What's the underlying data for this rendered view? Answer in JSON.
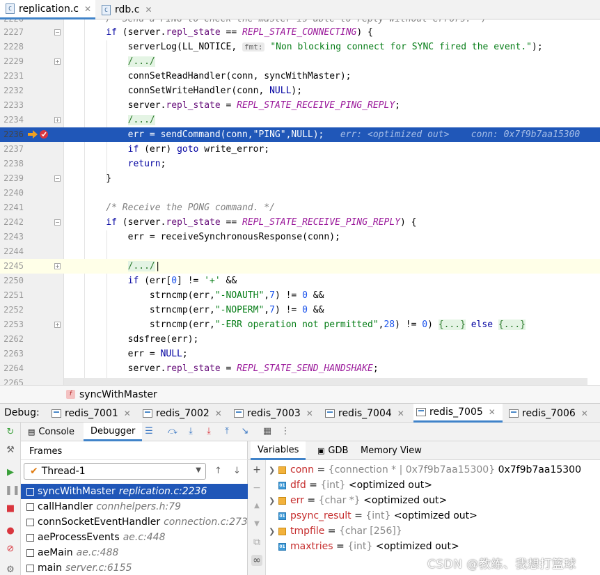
{
  "editor_tabs": [
    {
      "label": "replication.c",
      "icon": "c-file-icon",
      "active": true
    },
    {
      "label": "rdb.c",
      "icon": "c-file-icon",
      "active": false
    }
  ],
  "code_lines": [
    {
      "num": "2226",
      "text": "    /* Send a PING to check the master is able to reply without errors. */"
    },
    {
      "num": "2227",
      "text": "    if (server.repl_state == REPL_STATE_CONNECTING) {"
    },
    {
      "num": "2228",
      "text": "        serverLog(LL_NOTICE, fmt: \"Non blocking connect for SYNC fired the event.\");"
    },
    {
      "num": "2229",
      "text": "        /.../"
    },
    {
      "num": "2231",
      "text": "        connSetReadHandler(conn, syncWithMaster);"
    },
    {
      "num": "2232",
      "text": "        connSetWriteHandler(conn, NULL);"
    },
    {
      "num": "2233",
      "text": "        server.repl_state = REPL_STATE_RECEIVE_PING_REPLY;"
    },
    {
      "num": "2234",
      "text": "        /.../"
    },
    {
      "num": "2236",
      "text": "        err = sendCommand(conn,\"PING\",NULL);"
    },
    {
      "num": "2237",
      "text": "        if (err) goto write_error;"
    },
    {
      "num": "2238",
      "text": "        return;"
    },
    {
      "num": "2239",
      "text": "    }"
    },
    {
      "num": "2240",
      "text": ""
    },
    {
      "num": "2241",
      "text": "    /* Receive the PONG command. */"
    },
    {
      "num": "2242",
      "text": "    if (server.repl_state == REPL_STATE_RECEIVE_PING_REPLY) {"
    },
    {
      "num": "2243",
      "text": "        err = receiveSynchronousResponse(conn);"
    },
    {
      "num": "2244",
      "text": ""
    },
    {
      "num": "2245",
      "text": "        /.../"
    },
    {
      "num": "2250",
      "text": "        if (err[0] != '+' &&"
    },
    {
      "num": "2251",
      "text": "            strncmp(err,\"-NOAUTH\",7) != 0 &&"
    },
    {
      "num": "2252",
      "text": "            strncmp(err,\"-NOPERM\",7) != 0 &&"
    },
    {
      "num": "2253",
      "text": "            strncmp(err,\"-ERR operation not permitted\",28) != 0) {...} else {...}"
    },
    {
      "num": "2262",
      "text": "        sdsfree(err);"
    },
    {
      "num": "2263",
      "text": "        err = NULL;"
    },
    {
      "num": "2264",
      "text": "        server.repl_state = REPL_STATE_SEND_HANDSHAKE;"
    },
    {
      "num": "2265",
      "text": "    }"
    }
  ],
  "inline_values": {
    "err": "err: <optimized out>",
    "conn": "conn: 0x7f9b7aa15300"
  },
  "breadcrumb": {
    "badge": "f",
    "label": "syncWithMaster"
  },
  "debug": {
    "label": "Debug:",
    "sessions": [
      {
        "label": "redis_7001"
      },
      {
        "label": "redis_7002"
      },
      {
        "label": "redis_7003"
      },
      {
        "label": "redis_7004"
      },
      {
        "label": "redis_7005",
        "active": true
      },
      {
        "label": "redis_7006"
      }
    ],
    "subtabs": {
      "console": "Console",
      "debugger": "Debugger"
    },
    "frames_title": "Frames",
    "thread": "Thread-1",
    "frames": [
      {
        "fn": "syncWithMaster",
        "loc": "replication.c:2236",
        "selected": true
      },
      {
        "fn": "callHandler",
        "loc": "connhelpers.h:79"
      },
      {
        "fn": "connSocketEventHandler",
        "loc": "connection.c:273"
      },
      {
        "fn": "aeProcessEvents",
        "loc": "ae.c:448"
      },
      {
        "fn": "aeMain",
        "loc": "ae.c:488"
      },
      {
        "fn": "main",
        "loc": "server.c:6155"
      }
    ],
    "var_tabs": {
      "variables": "Variables",
      "gdb": "GDB",
      "memory": "Memory View"
    },
    "variables": [
      {
        "name": "conn",
        "type": "{connection * | 0x7f9b7aa15300}",
        "value": "0x7f9b7aa15300",
        "expandable": true,
        "icon": "field"
      },
      {
        "name": "dfd",
        "type": "{int}",
        "value": "<optimized out>",
        "expandable": false,
        "icon": "prim"
      },
      {
        "name": "err",
        "type": "{char *}",
        "value": "<optimized out>",
        "expandable": true,
        "icon": "field"
      },
      {
        "name": "psync_result",
        "type": "{int}",
        "value": "<optimized out>",
        "expandable": false,
        "icon": "prim"
      },
      {
        "name": "tmpfile",
        "type": "{char [256]}",
        "value": "",
        "expandable": true,
        "icon": "field"
      },
      {
        "name": "maxtries",
        "type": "{int}",
        "value": "<optimized out>",
        "expandable": false,
        "icon": "prim"
      }
    ]
  },
  "watermark": "CSDN @教练、我想打篮球"
}
